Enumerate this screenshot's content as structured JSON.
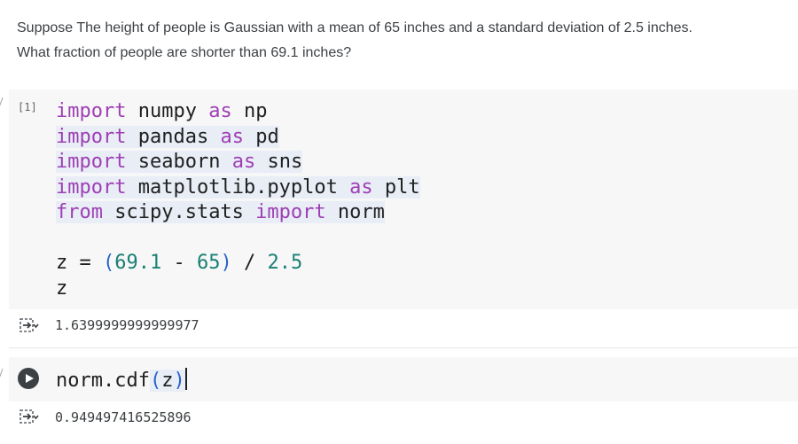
{
  "question": {
    "line1": "Suppose The height of people is Gaussian with a mean of 65 inches and a standard deviation of 2.5 inches.",
    "line2": "What fraction of people are shorter than 69.1 inches?"
  },
  "cell1": {
    "execution_count": "[1]",
    "lines": [
      {
        "kw1": "import",
        "mod": " numpy ",
        "kw2": "as",
        "alias": " np"
      },
      {
        "kw1": "import",
        "mod": " pandas ",
        "kw2": "as",
        "alias": " pd"
      },
      {
        "kw1": "import",
        "mod": " seaborn ",
        "kw2": "as",
        "alias": " sns"
      },
      {
        "kw1": "import",
        "mod": " matplotlib.pyplot ",
        "kw2": "as",
        "alias": " plt"
      },
      {
        "kw1": "from",
        "mod": " scipy.stats ",
        "kw2": "import",
        "alias": " norm"
      }
    ],
    "expr": {
      "var": "z",
      "op": " = ",
      "lparen": "(",
      "a": "69.1",
      "minus": " - ",
      "b": "65",
      "rparen": ")",
      "div": " / ",
      "c": "2.5",
      "last": "z"
    },
    "output": "1.6399999999999977"
  },
  "cell2": {
    "code_fn": "norm.cdf",
    "code_lparen": "(",
    "code_arg": "z",
    "code_rparen": ")",
    "output": "0.949497416525896"
  },
  "colors": {
    "keyword": "#9e3fb4",
    "number": "#1a7f74",
    "paren": "#2a62c9",
    "cell_bg": "#f7f7f7"
  },
  "icons": {
    "run": "run-cell-icon",
    "output": "output-toggle-icon"
  }
}
